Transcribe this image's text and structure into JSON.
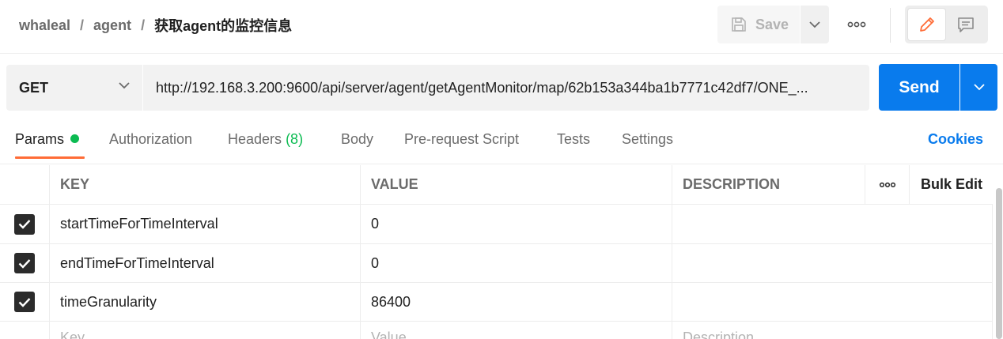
{
  "header": {
    "breadcrumb": [
      "whaleal",
      "agent"
    ],
    "separator": "/",
    "current": "获取agent的监控信息",
    "save_label": "Save"
  },
  "request": {
    "method": "GET",
    "url": "http://192.168.3.200:9600/api/server/agent/getAgentMonitor/map/62b153a344ba1b7771c42df7/ONE_...",
    "send_label": "Send"
  },
  "tabs": {
    "params": "Params",
    "authorization": "Authorization",
    "headers": "Headers",
    "headers_count": "(8)",
    "body": "Body",
    "prerequest": "Pre-request Script",
    "tests": "Tests",
    "settings": "Settings",
    "cookies": "Cookies"
  },
  "table": {
    "columns": {
      "key": "KEY",
      "value": "VALUE",
      "description": "DESCRIPTION",
      "bulk_edit": "Bulk Edit"
    },
    "rows": [
      {
        "key": "startTimeForTimeInterval",
        "value": "0",
        "description": "",
        "checked": true
      },
      {
        "key": "endTimeForTimeInterval",
        "value": "0",
        "description": "",
        "checked": true
      },
      {
        "key": "timeGranularity",
        "value": "86400",
        "description": "",
        "checked": true
      }
    ],
    "placeholders": {
      "key": "Key",
      "value": "Value",
      "description": "Description"
    }
  },
  "colors": {
    "accent": "#ff6c37",
    "send": "#097bed",
    "params_dot": "#0cbb52"
  }
}
